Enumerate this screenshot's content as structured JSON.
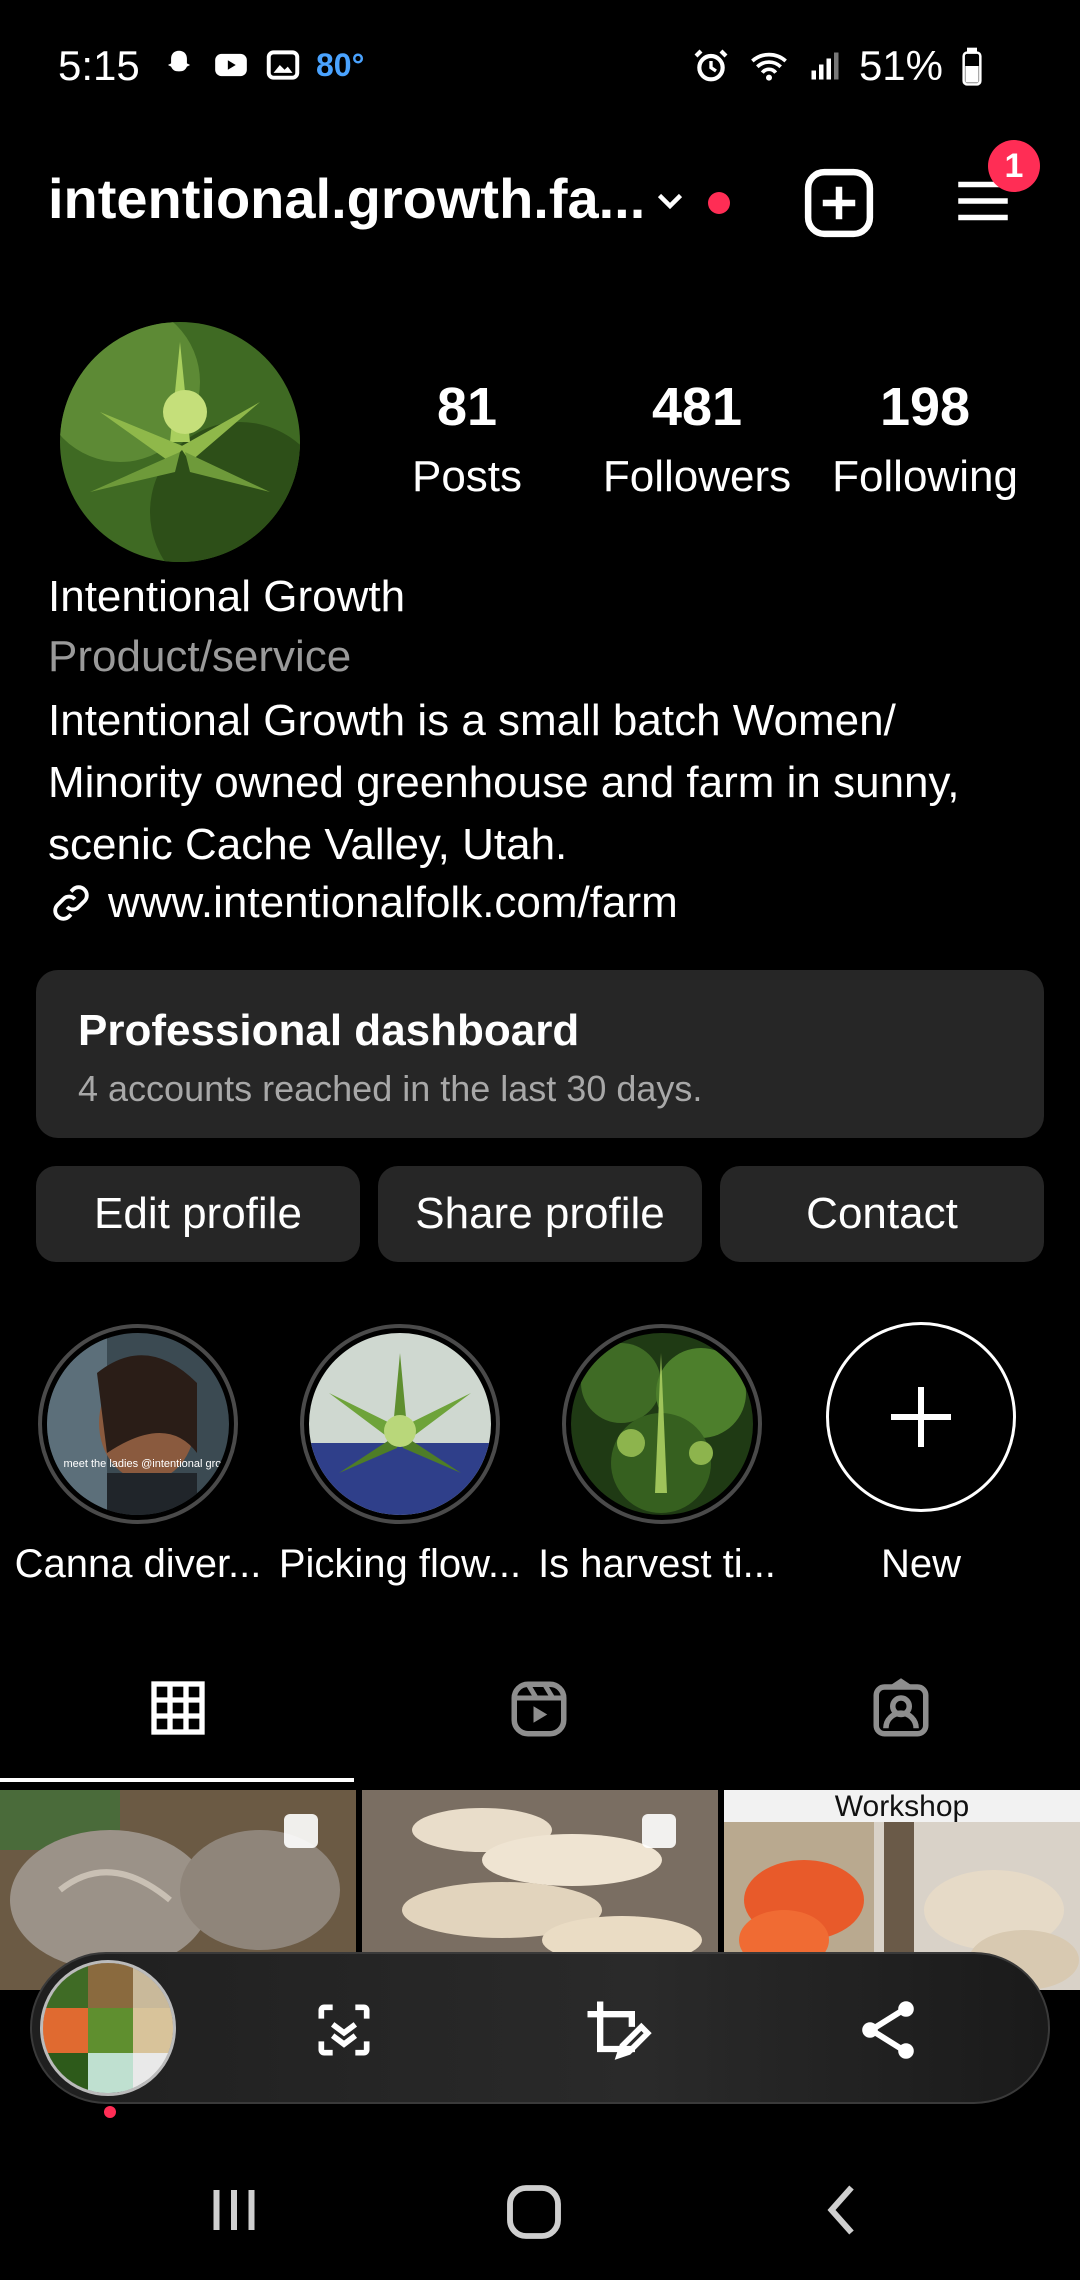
{
  "status_bar": {
    "time": "5:15",
    "temperature": "80°",
    "battery": "51%"
  },
  "header": {
    "username": "intentional.growth.fa...",
    "notification_count": "1"
  },
  "profile": {
    "posts_count": "81",
    "posts_label": "Posts",
    "followers_count": "481",
    "followers_label": "Followers",
    "following_count": "198",
    "following_label": "Following",
    "name": "Intentional Growth",
    "category": "Product/service",
    "bio_line1": "Intentional Growth is a small batch Women/",
    "bio_line2": "Minority owned greenhouse and farm in sunny,",
    "bio_line3": "scenic Cache Valley, Utah.",
    "link": "www.intentionalfolk.com/farm"
  },
  "dashboard": {
    "title": "Professional dashboard",
    "subtitle": "4 accounts reached in the last 30 days."
  },
  "actions": {
    "edit": "Edit profile",
    "share": "Share profile",
    "contact": "Contact"
  },
  "highlights": [
    {
      "label": "Canna diver..."
    },
    {
      "label": "Picking flow..."
    },
    {
      "label": "Is harvest ti..."
    },
    {
      "label": "New"
    }
  ],
  "highlight_overlay_text": "meet the ladies @intentional growth",
  "grid": {
    "third_thumb_caption": "Workshop"
  },
  "colors": {
    "background": "#000000",
    "card": "#262626",
    "accent_red": "#ff2d55",
    "secondary_text": "#9a9a9a"
  }
}
